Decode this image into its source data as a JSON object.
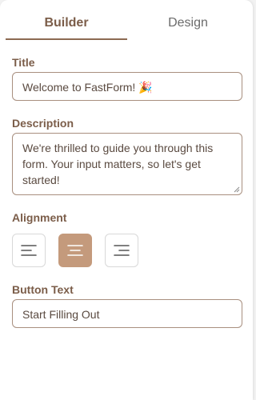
{
  "tabs": [
    {
      "label": "Builder",
      "active": true
    },
    {
      "label": "Design",
      "active": false
    }
  ],
  "title_section": {
    "label": "Title",
    "value": "Welcome to FastForm! 🎉"
  },
  "description_section": {
    "label": "Description",
    "value": "We're thrilled to guide you through this form. Your input matters, so let's get started!"
  },
  "alignment_section": {
    "label": "Alignment",
    "options": [
      {
        "icon": "align-left-icon",
        "selected": false
      },
      {
        "icon": "align-center-icon",
        "selected": true
      },
      {
        "icon": "align-right-icon",
        "selected": false
      }
    ]
  },
  "button_text_section": {
    "label": "Button Text",
    "value": "Start Filling Out"
  },
  "colors": {
    "accent": "#8c6a52",
    "selected_button": "#c49a7c",
    "label_text": "#7b5d49"
  }
}
